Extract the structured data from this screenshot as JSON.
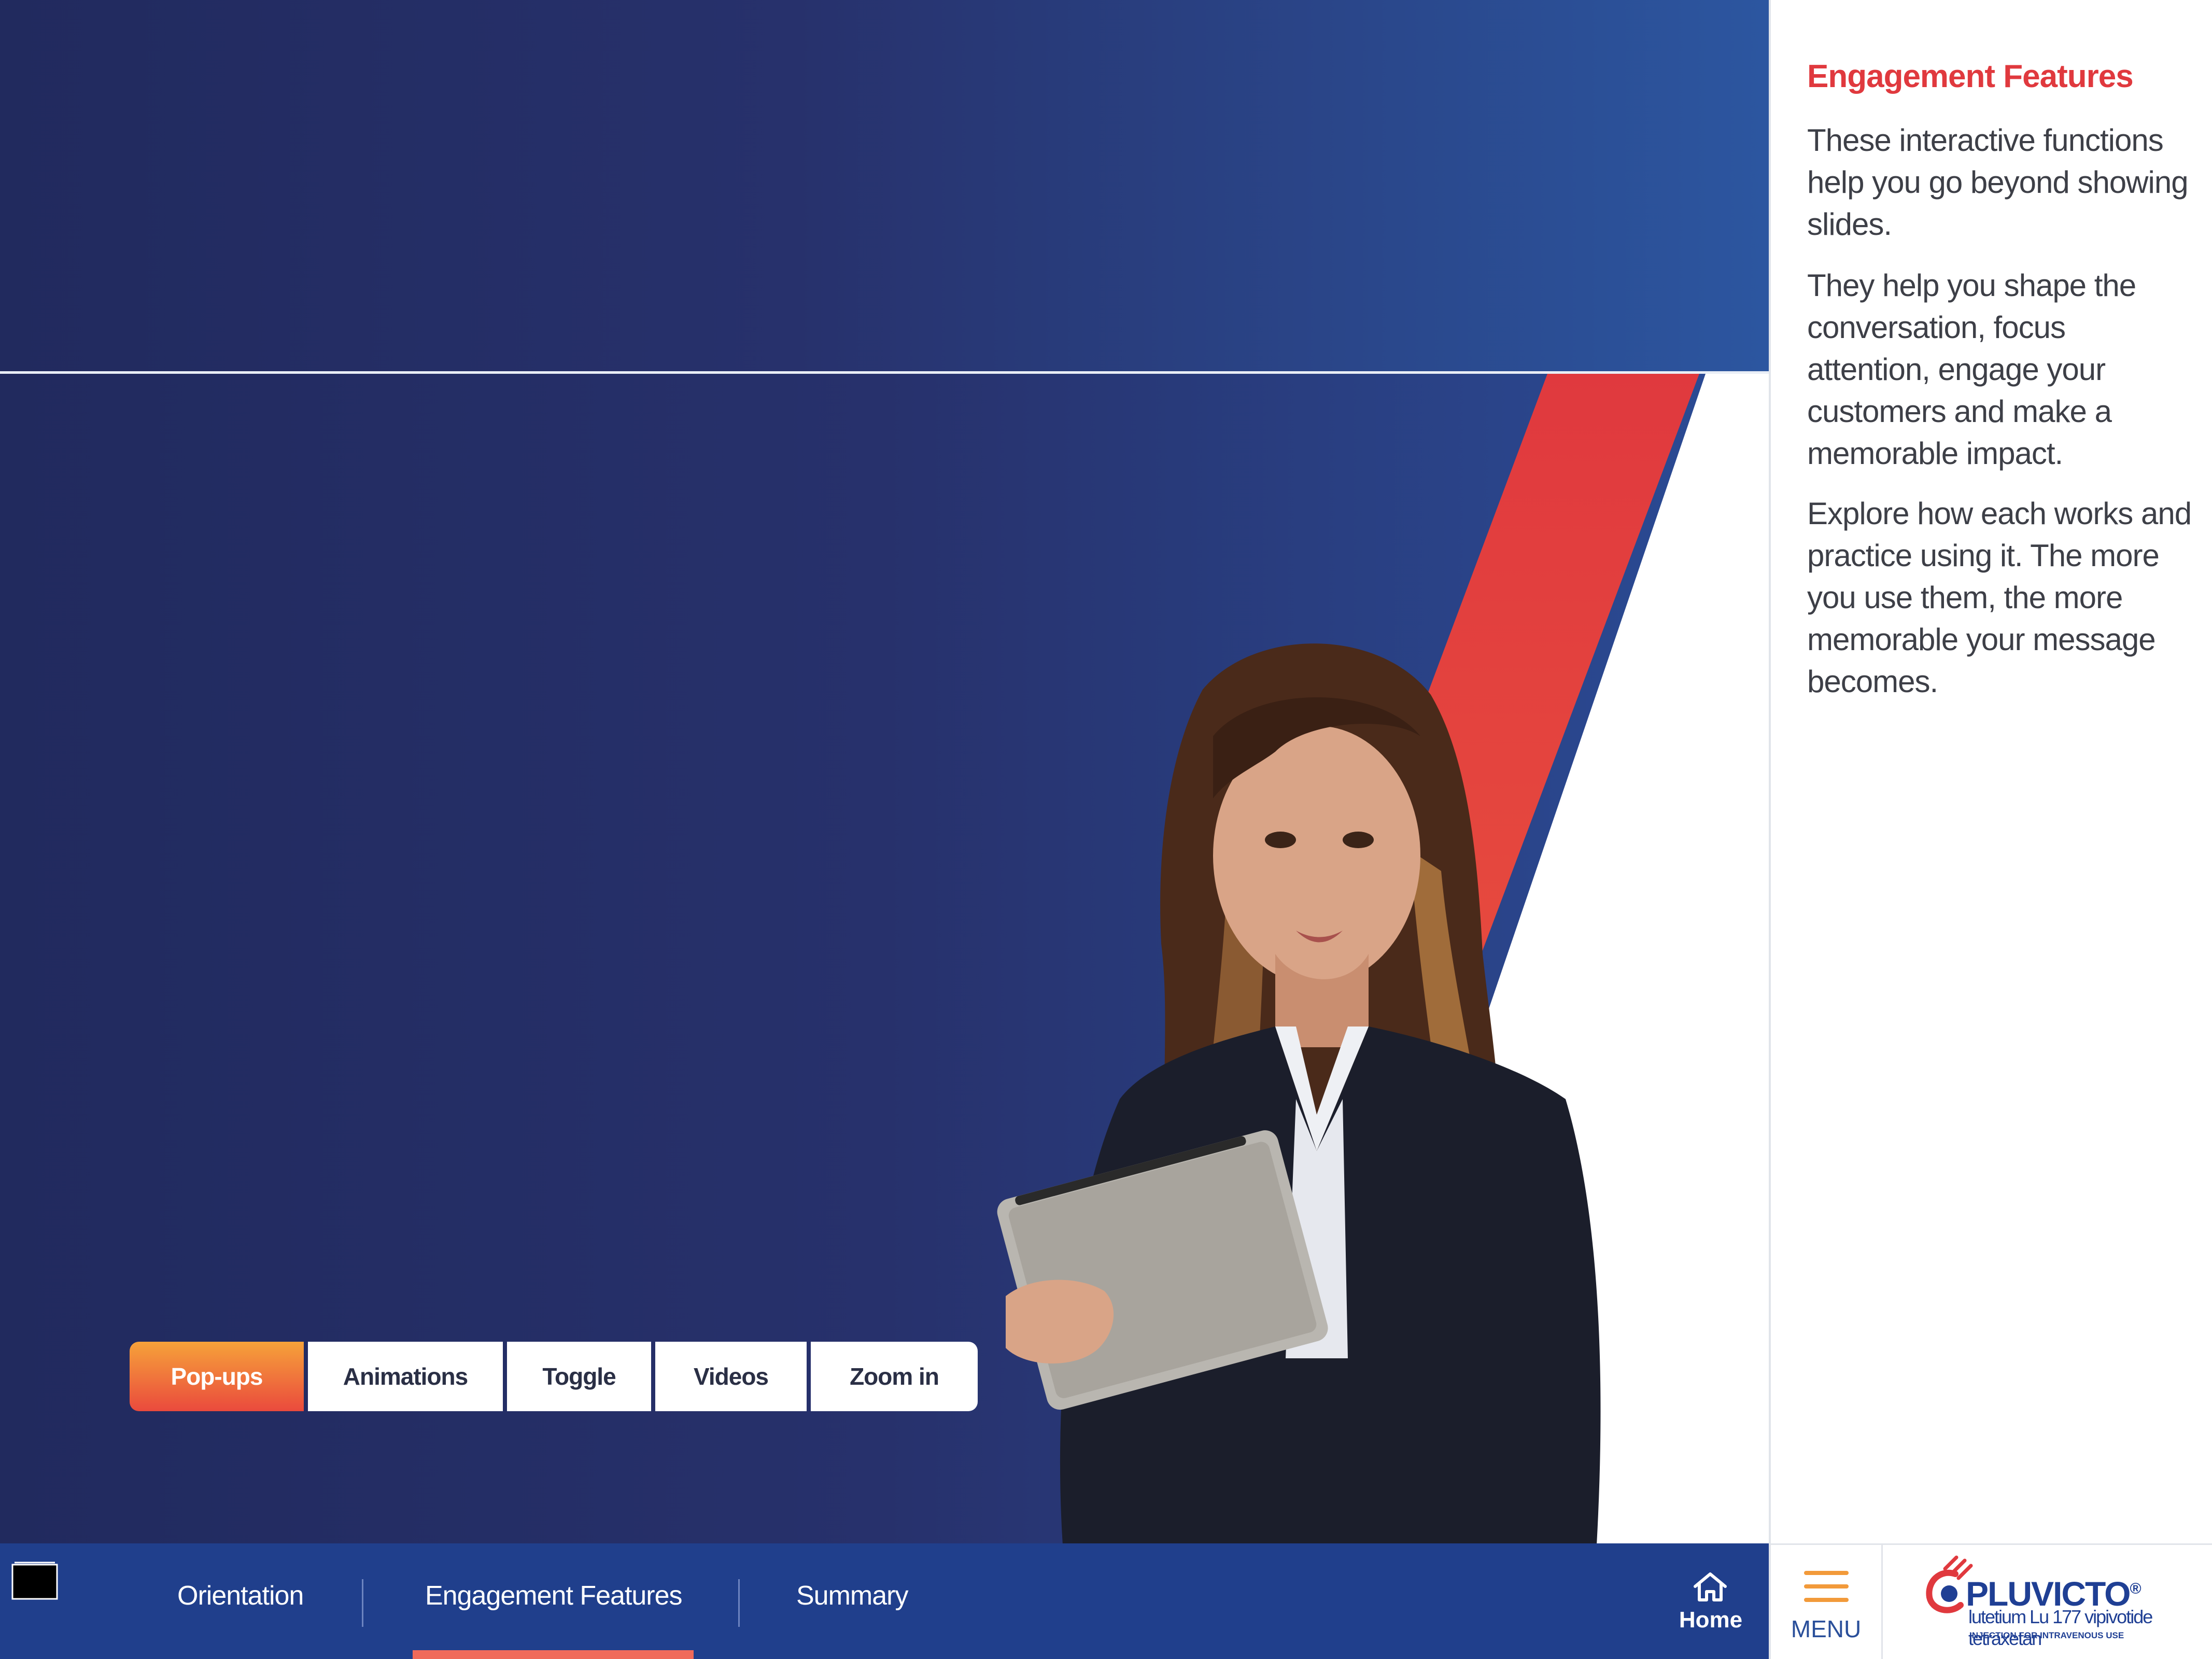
{
  "colors": {
    "navy": "#212a5e",
    "blue": "#2b4c96",
    "accent_red": "#e0393e",
    "accent_orange": "#f6a23a",
    "nav_bar": "#203f8c",
    "nav_underline": "#f06a5a"
  },
  "feature_tabs": [
    {
      "label": "Pop-ups",
      "active": true
    },
    {
      "label": "Animations",
      "active": false
    },
    {
      "label": "Toggle",
      "active": false
    },
    {
      "label": "Videos",
      "active": false
    },
    {
      "label": "Zoom in",
      "active": false
    }
  ],
  "sidebar": {
    "title": "Engagement Features",
    "paragraphs": [
      "These interactive functions help you go beyond showing slides.",
      "They help you shape the conversation, focus attention, engage your customers and make a memorable impact.",
      "Explore how each works and practice using it. The more you use them, the more memorable your message becomes."
    ]
  },
  "bottom_nav": {
    "items": [
      "Orientation",
      "Engagement Features",
      "Summary"
    ],
    "active_item": "Engagement Features",
    "home_label": "Home",
    "menu_label": "MENU"
  },
  "logo": {
    "name": "PLUVICTO",
    "mark": "®",
    "subtitle": "lutetium Lu 177 vipivotide tetraxetan",
    "tagline": "INJECTION FOR INTRAVENOUS USE"
  },
  "icons": [
    "folder-icon",
    "home-icon",
    "hamburger-menu-icon",
    "pluvicto-logo-icon"
  ]
}
